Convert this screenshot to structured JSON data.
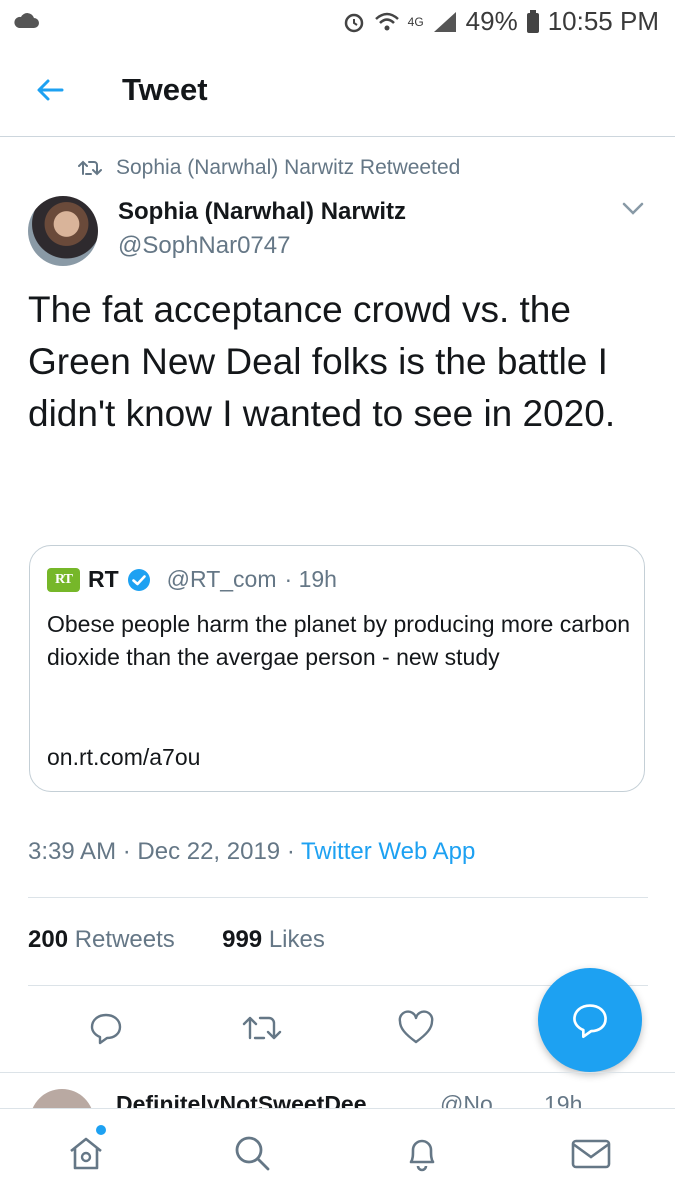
{
  "status_bar": {
    "network": "4G",
    "battery": "49%",
    "time": "10:55 PM"
  },
  "header": {
    "title": "Tweet"
  },
  "retweet_context": {
    "label": "Sophia (Narwhal) Narwitz Retweeted"
  },
  "tweet": {
    "author_name": "Sophia (Narwhal) Narwitz",
    "author_handle": "@SophNar0747",
    "text": "The fat acceptance crowd vs. the Green New Deal folks is the battle I didn't know I wanted to see in 2020.",
    "timestamp": "3:39 AM · Dec 22, 2019 · ",
    "source": "Twitter Web App",
    "retweets_count": "200",
    "retweets_label": "Retweets",
    "likes_count": "999",
    "likes_label": "Likes"
  },
  "quoted_tweet": {
    "logo_text": "RT",
    "author_name": "RT",
    "verified": true,
    "author_handle": "@RT_com",
    "time": "· 19h",
    "text": "Obese people harm the planet by producing more carbon dioxide than the avergae person - new study",
    "link": "on.rt.com/a7ou"
  },
  "next_reply": {
    "author_name": "DefinitelyNotSweetDee",
    "author_handle": "@No...",
    "time": "19h"
  },
  "icons": {
    "back": "arrow-left-icon",
    "retweet": "retweet-icon",
    "caret": "chevron-down-icon",
    "reply": "reply-icon",
    "like": "heart-icon",
    "compose": "compose-reply-icon",
    "home": "home-icon",
    "search": "search-icon",
    "notifications": "bell-icon",
    "messages": "mail-icon"
  },
  "colors": {
    "accent": "#1da1f2",
    "secondary_text": "#657786",
    "rt_brand": "#76b729"
  }
}
